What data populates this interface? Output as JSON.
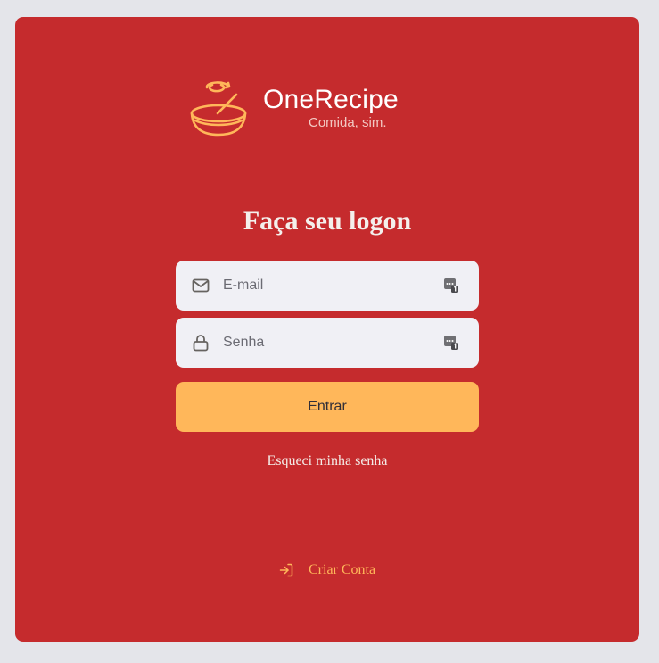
{
  "brand": {
    "name": "OneRecipe",
    "tagline": "Comida, sim."
  },
  "login": {
    "title": "Faça seu logon",
    "email_placeholder": "E-mail",
    "password_placeholder": "Senha",
    "submit_label": "Entrar",
    "forgot_label": "Esqueci minha senha",
    "create_account_label": "Criar Conta"
  },
  "icons": {
    "logo": "bowl-icon",
    "email": "mail-icon",
    "password": "lock-icon",
    "autofill": "password-manager-icon",
    "create_account": "log-in-icon"
  },
  "colors": {
    "page_background": "#e4e5ea",
    "card_background": "#c52b2d",
    "accent": "#ffb75a",
    "input_background": "#f0f0f5",
    "text_light": "#f4ede8"
  }
}
